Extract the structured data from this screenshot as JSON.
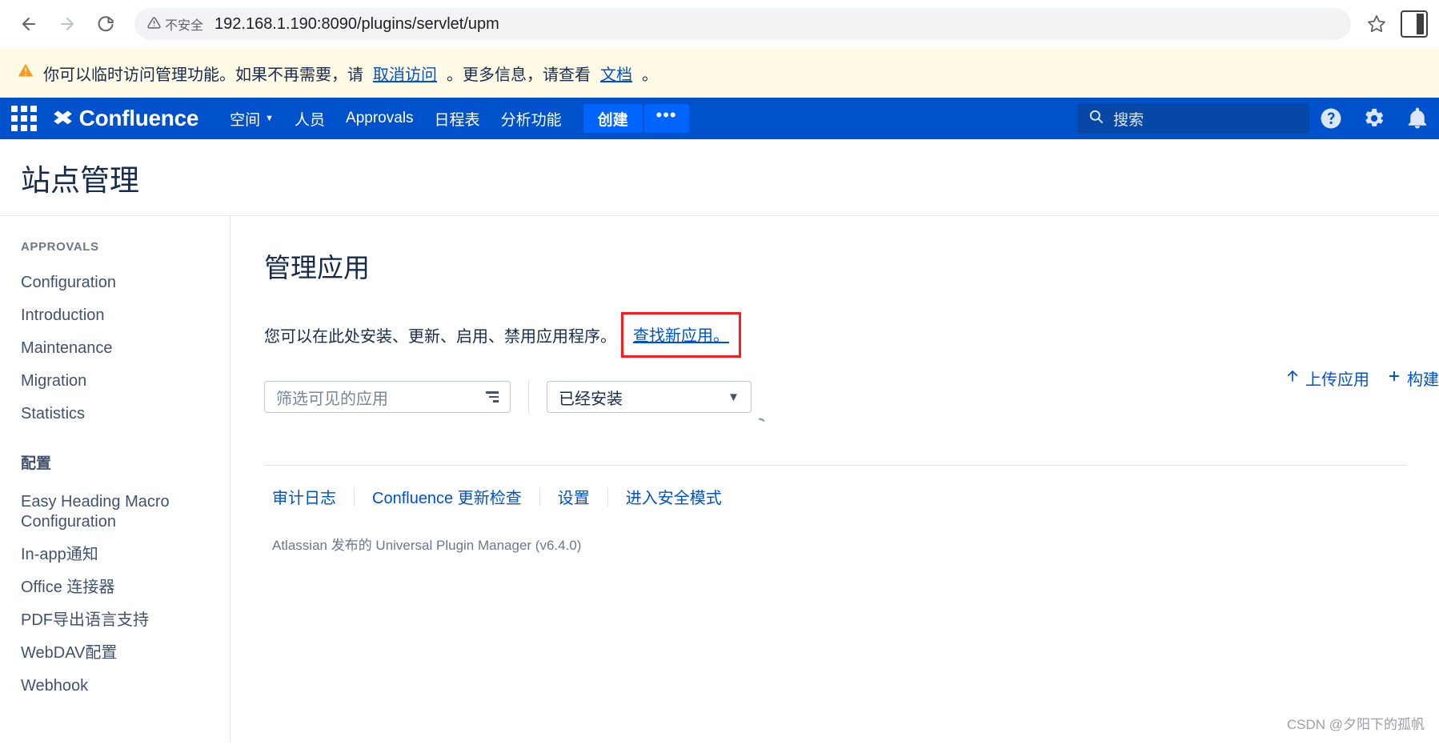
{
  "browser": {
    "back_icon": "arrow-left-icon",
    "forward_icon": "arrow-right-icon",
    "reload_icon": "reload-icon",
    "security_label": "不安全",
    "url": "192.168.1.190:8090/plugins/servlet/upm",
    "bookmark_icon": "star-icon",
    "side_panel_icon": "side-panel-icon"
  },
  "alert": {
    "text_before": "你可以临时访问管理功能。如果不再需要，请",
    "link1": "取消访问",
    "text_middle": "。更多信息，请查看",
    "link2": "文档",
    "text_after": "。"
  },
  "topnav": {
    "brand": "Confluence",
    "items": [
      {
        "label": "空间",
        "has_caret": true
      },
      {
        "label": "人员",
        "has_caret": false
      },
      {
        "label": "Approvals",
        "has_caret": false
      },
      {
        "label": "日程表",
        "has_caret": false
      },
      {
        "label": "分析功能",
        "has_caret": false
      }
    ],
    "create_label": "创建",
    "more_label": "•••",
    "search_placeholder": "搜索",
    "help_icon": "help-icon",
    "settings_icon": "gear-icon",
    "notifications_icon": "bell-icon"
  },
  "page": {
    "title": "站点管理"
  },
  "sidebar": {
    "section1_label": "APPROVALS",
    "section1_items": [
      "Configuration",
      "Introduction",
      "Maintenance",
      "Migration",
      "Statistics"
    ],
    "section2_label": "配置",
    "section2_items": [
      "Easy Heading Macro Configuration",
      "In-app通知",
      "Office 连接器",
      "PDF导出语言支持",
      "WebDAV配置",
      "Webhook"
    ]
  },
  "main": {
    "heading": "管理应用",
    "description": "您可以在此处安装、更新、启用、禁用应用程序。",
    "find_new_apps_link": "查找新应用。",
    "highlight_color": "#ff1c1c",
    "filter_placeholder": "筛选可见的应用",
    "filter_icon": "filter-icon",
    "select_value": "已经安装",
    "select_chevron_icon": "chevron-down-icon",
    "upload_app_label": "上传应用",
    "upload_icon": "upload-arrow-icon",
    "build_label": "构建",
    "build_icon": "plus-icon",
    "bottom_links": [
      "审计日志",
      "Confluence 更新检查",
      "设置",
      "进入安全模式"
    ],
    "footer_note": "Atlassian 发布的 Universal Plugin Manager (v6.4.0)"
  },
  "watermark": "CSDN @夕阳下的孤帆"
}
